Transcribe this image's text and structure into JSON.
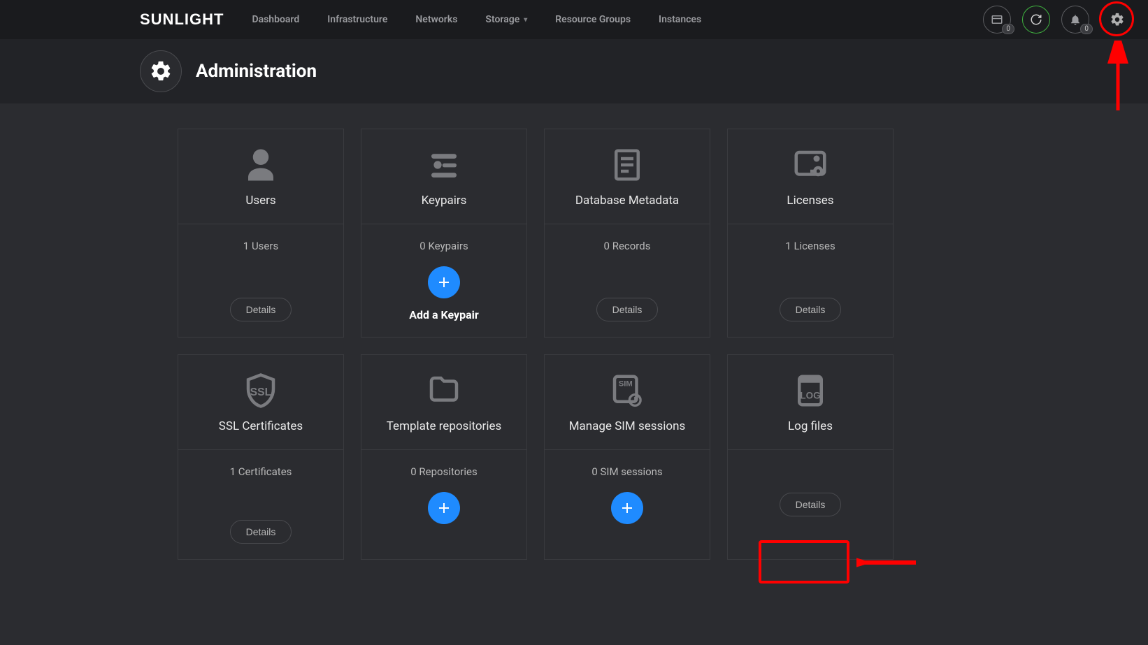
{
  "brand": "SUNLIGHT",
  "nav": {
    "dashboard": "Dashboard",
    "infrastructure": "Infrastructure",
    "networks": "Networks",
    "storage": "Storage",
    "resource_groups": "Resource Groups",
    "instances": "Instances"
  },
  "topbar": {
    "badge1": "0",
    "badge2": "0"
  },
  "page": {
    "title": "Administration"
  },
  "buttons": {
    "details": "Details",
    "add_keypair": "Add a Keypair"
  },
  "cards": {
    "users": {
      "title": "Users",
      "count": "1 Users"
    },
    "keypairs": {
      "title": "Keypairs",
      "count": "0 Keypairs"
    },
    "db": {
      "title": "Database Metadata",
      "count": "0 Records"
    },
    "licenses": {
      "title": "Licenses",
      "count": "1 Licenses"
    },
    "ssl": {
      "title": "SSL Certificates",
      "count": "1 Certificates"
    },
    "templates": {
      "title": "Template repositories",
      "count": "0 Repositories"
    },
    "sim": {
      "title": "Manage SIM sessions",
      "count": "0 SIM sessions"
    },
    "logs": {
      "title": "Log files"
    }
  },
  "annotations": {
    "gear_highlighted": true,
    "log_details_highlighted": true
  }
}
